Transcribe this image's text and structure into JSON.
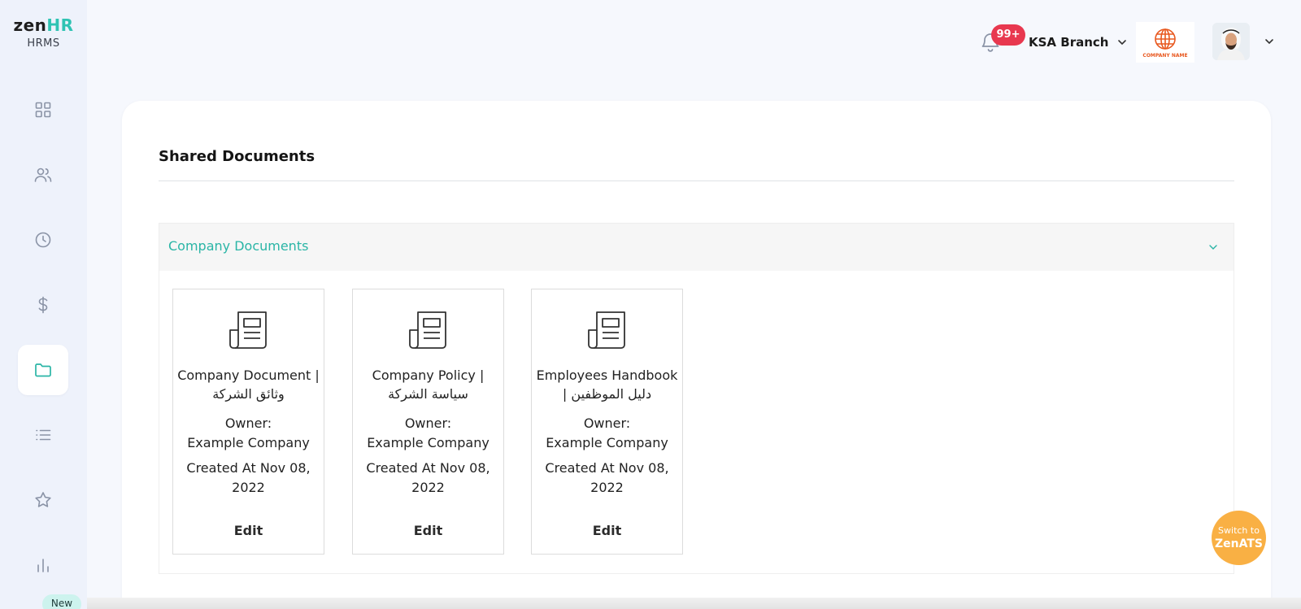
{
  "logo": {
    "brand_part1": "zen",
    "brand_part2": "HR",
    "subtitle": "HRMS"
  },
  "sidebar": {
    "items": [
      {
        "icon": "dashboard-grid-icon"
      },
      {
        "icon": "users-icon"
      },
      {
        "icon": "clock-icon"
      },
      {
        "icon": "dollar-icon"
      },
      {
        "icon": "folder-icon",
        "active": true
      },
      {
        "icon": "list-icon"
      },
      {
        "icon": "star-icon"
      },
      {
        "icon": "bar-chart-icon"
      }
    ],
    "new_badge": "New"
  },
  "header": {
    "notification_count": "99+",
    "branch": "KSA Branch",
    "company_logo_text": "COMPANY NAME"
  },
  "page": {
    "title": "Shared Documents",
    "section_title": "Company Documents"
  },
  "documents": [
    {
      "name": "Company Document | وثائق الشركة",
      "owner_label": "Owner:",
      "owner": "Example Company",
      "created": "Created At Nov 08, 2022",
      "edit": "Edit"
    },
    {
      "name": "Company Policy | سياسة الشركة",
      "owner_label": "Owner:",
      "owner": "Example Company",
      "created": "Created At Nov 08, 2022",
      "edit": "Edit"
    },
    {
      "name": "Employees Handbook | دليل الموظفين",
      "owner_label": "Owner:",
      "owner": "Example Company",
      "created": "Created At Nov 08, 2022",
      "edit": "Edit"
    }
  ],
  "switch_button": {
    "line1": "Switch to",
    "line2": "ZenATS"
  },
  "colors": {
    "accent": "#2ab5a6",
    "badge": "#e8384f",
    "switch": "#f9b044"
  }
}
